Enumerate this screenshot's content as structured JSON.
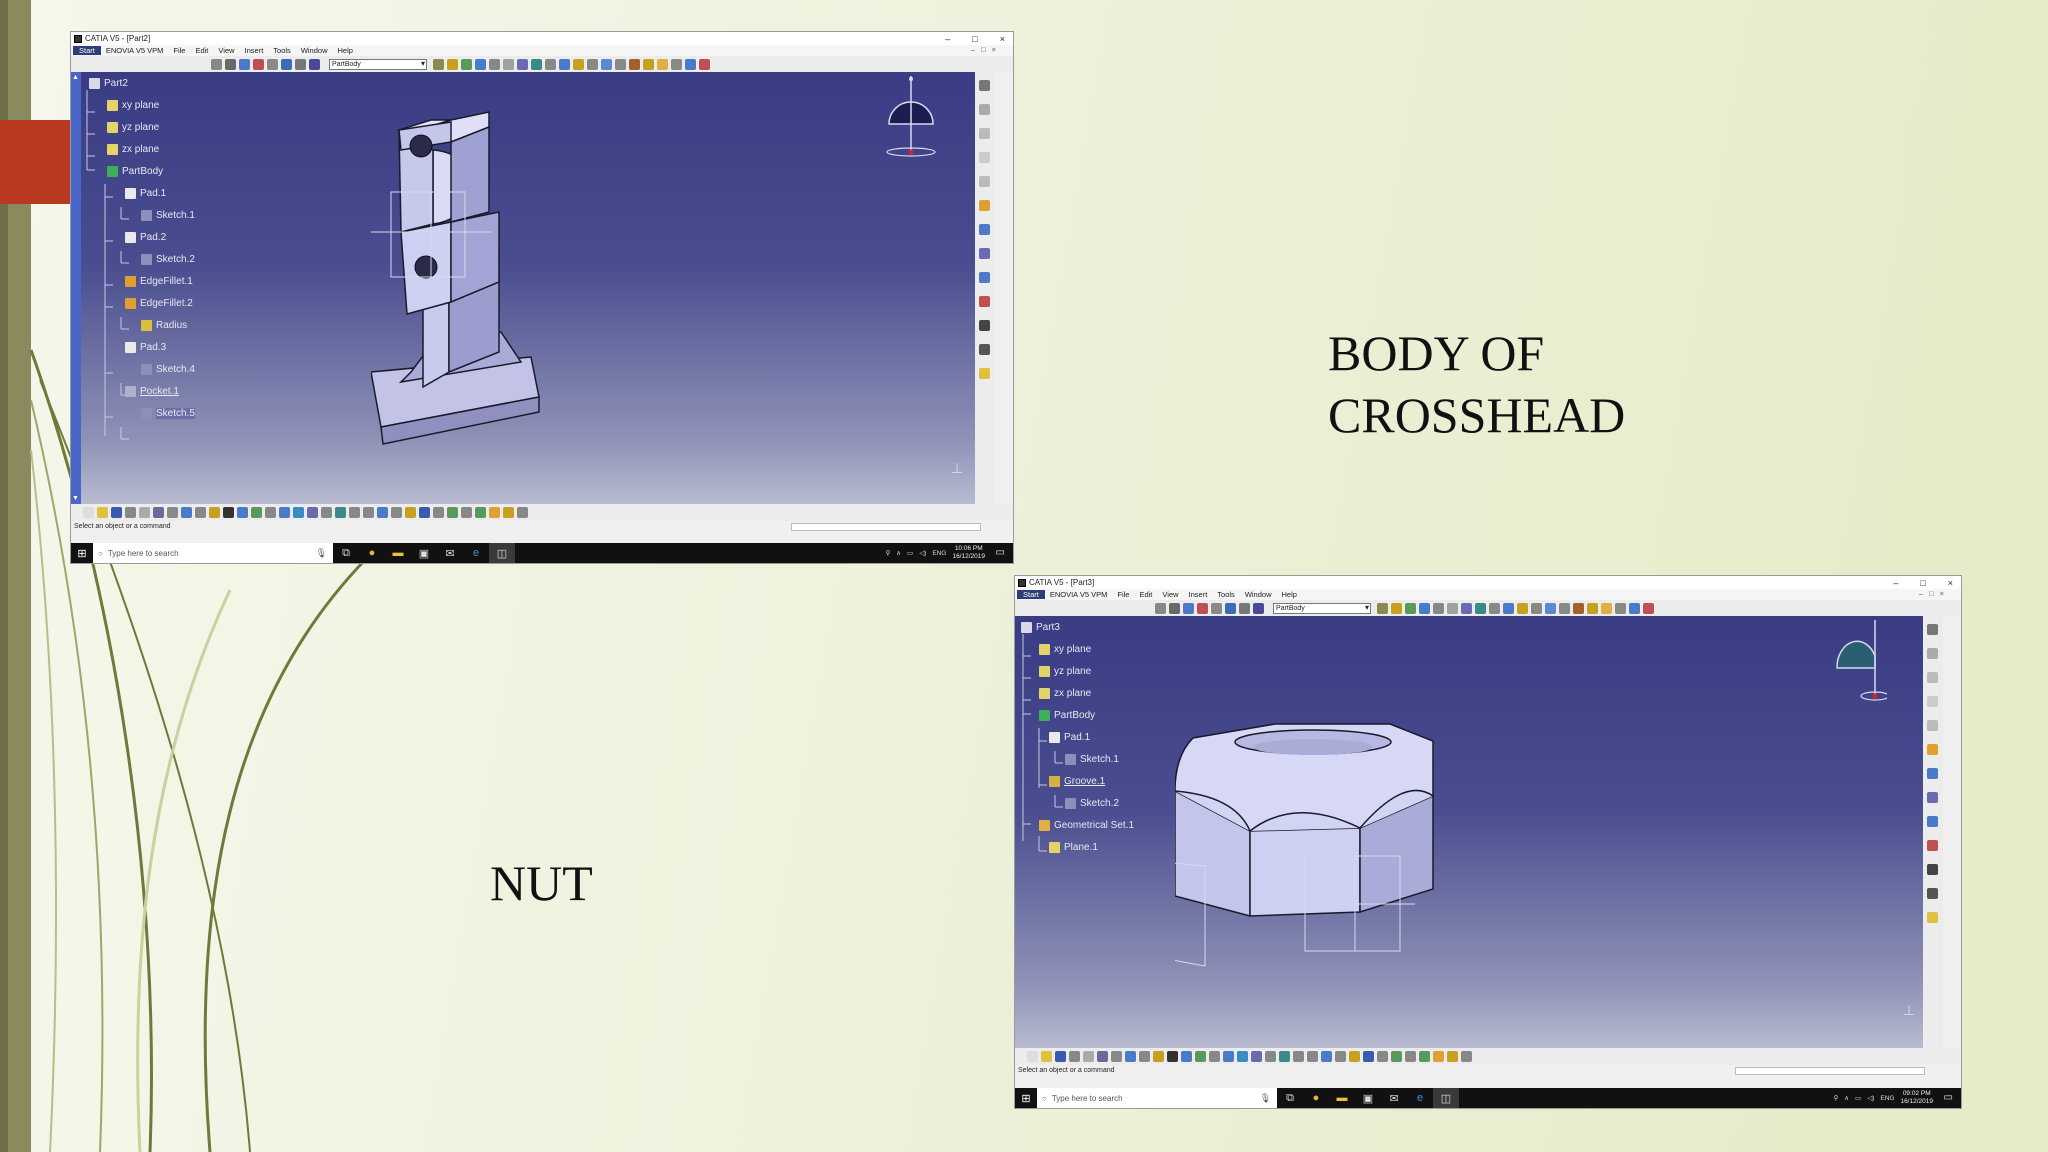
{
  "slide": {
    "label_body": "BODY OF\nCROSSHEAD",
    "label_nut": "NUT"
  },
  "colors": {
    "slide_stripe": "#8a8a5e",
    "slide_accent": "#b8391f",
    "viewport_top": "#3a3c84",
    "tree_bar": "#4b66c8",
    "part_fill": "#b8b9e0"
  },
  "window1": {
    "title": "CATIA V5 - [Part2]",
    "menu": [
      "Start",
      "ENOVIA V5 VPM",
      "File",
      "Edit",
      "View",
      "Insert",
      "Tools",
      "Window",
      "Help"
    ],
    "controls": [
      "–",
      "□",
      "×"
    ],
    "body_combo": "PartBody",
    "tree": [
      {
        "label": "Part2",
        "icon": "part-icon"
      },
      {
        "label": "xy plane",
        "icon": "plane-icon"
      },
      {
        "label": "yz plane",
        "icon": "plane-icon"
      },
      {
        "label": "zx plane",
        "icon": "plane-icon"
      },
      {
        "label": "PartBody",
        "icon": "body-icon"
      },
      {
        "label": "Pad.1",
        "icon": "pad-icon"
      },
      {
        "label": "Sketch.1",
        "icon": "sketch-icon"
      },
      {
        "label": "Pad.2",
        "icon": "pad-icon"
      },
      {
        "label": "Sketch.2",
        "icon": "sketch-icon"
      },
      {
        "label": "EdgeFillet.1",
        "icon": "fillet-icon"
      },
      {
        "label": "EdgeFillet.2",
        "icon": "fillet-icon"
      },
      {
        "label": "Radius",
        "icon": "parameter-icon"
      },
      {
        "label": "Pad.3",
        "icon": "pad-icon"
      },
      {
        "label": "Sketch.4",
        "icon": "sketch-icon"
      },
      {
        "label": "Pocket.1",
        "icon": "pocket-icon"
      },
      {
        "label": "Sketch.5",
        "icon": "sketch-icon"
      }
    ],
    "status": "Select an object or a command",
    "taskbar": {
      "search_placeholder": "Type here to search",
      "lang": "ENG",
      "time": "10:06 PM",
      "date": "16/12/2019"
    }
  },
  "window2": {
    "title": "CATIA V5 - [Part3]",
    "menu": [
      "Start",
      "ENOVIA V5 VPM",
      "File",
      "Edit",
      "View",
      "Insert",
      "Tools",
      "Window",
      "Help"
    ],
    "controls": [
      "–",
      "□",
      "×"
    ],
    "body_combo": "PartBody",
    "tree": [
      {
        "label": "Part3",
        "icon": "part-icon"
      },
      {
        "label": "xy plane",
        "icon": "plane-icon"
      },
      {
        "label": "yz plane",
        "icon": "plane-icon"
      },
      {
        "label": "zx plane",
        "icon": "plane-icon"
      },
      {
        "label": "PartBody",
        "icon": "body-icon"
      },
      {
        "label": "Pad.1",
        "icon": "pad-icon"
      },
      {
        "label": "Sketch.1",
        "icon": "sketch-icon"
      },
      {
        "label": "Groove.1",
        "icon": "groove-icon"
      },
      {
        "label": "Sketch.2",
        "icon": "sketch-icon"
      },
      {
        "label": "Geometrical Set.1",
        "icon": "geoset-icon"
      },
      {
        "label": "Plane.1",
        "icon": "plane-icon"
      }
    ],
    "status": "Select an object or a command",
    "taskbar": {
      "search_placeholder": "Type here to search",
      "lang": "ENG",
      "time": "09:02 PM",
      "date": "16/12/2019"
    }
  }
}
